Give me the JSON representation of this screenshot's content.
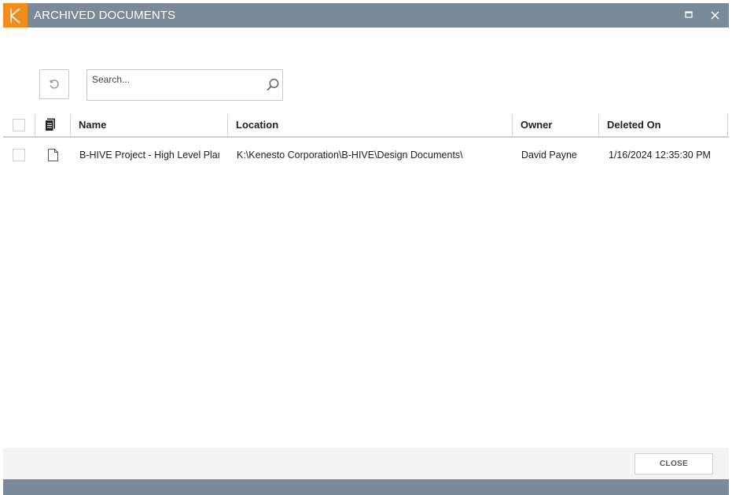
{
  "window": {
    "title": "ARCHIVED DOCUMENTS",
    "logo_letter": "K",
    "brand_color": "#f28c1b",
    "titlebar_color": "#7a8a99"
  },
  "toolbar": {
    "refresh_icon": "undo-icon",
    "search_placeholder": "Search...",
    "search_value": ""
  },
  "grid": {
    "columns": {
      "select": "",
      "type_icon": "document-icon",
      "name": "Name",
      "location": "Location",
      "owner": "Owner",
      "deleted_on": "Deleted On"
    },
    "rows": [
      {
        "selected": false,
        "type_icon": "file-icon",
        "name": "B-HIVE Project - High Level Plan",
        "location": "K:\\Kenesto Corporation\\B-HIVE\\Design Documents\\",
        "owner": "David Payne",
        "deleted_on": "1/16/2024 12:35:30 PM"
      }
    ]
  },
  "footer": {
    "close_label": "CLOSE"
  }
}
